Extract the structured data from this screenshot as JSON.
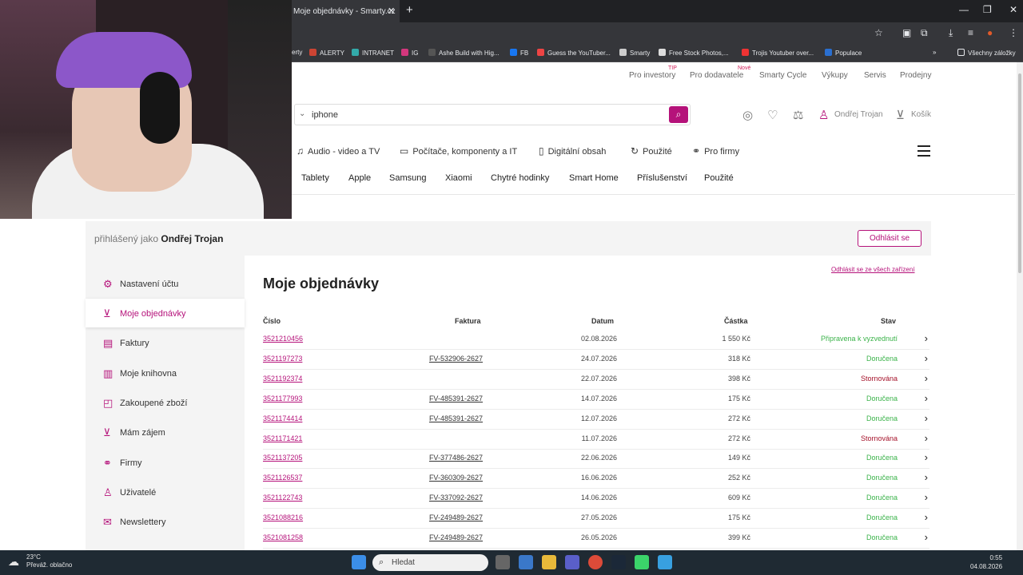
{
  "browser": {
    "tab_title": "Moje objednávky - Smarty.cz",
    "bookmarks": [
      "erty",
      "ALERTY",
      "INTRANET",
      "IG",
      "Ashe Build with Hig...",
      "FB",
      "Guess the YouTuber...",
      "Smarty",
      "Free Stock Photos,...",
      "Trojis Youtuber over...",
      "Populace"
    ],
    "all_bookmarks": "Všechny záložky"
  },
  "topnav": {
    "items": [
      "Pro investory",
      "Pro dodavatele",
      "Smarty Cycle",
      "Výkupy",
      "Servis",
      "Prodejny"
    ],
    "badge_tip": "TIP",
    "badge_new": "Nové"
  },
  "search": {
    "value": "iphone"
  },
  "header": {
    "user": "Ondřej Trojan",
    "cart": "Košík"
  },
  "categories": [
    "Audio - video a TV",
    "Počítače, komponenty a IT",
    "Digitální obsah",
    "Použité",
    "Pro firmy"
  ],
  "subnav": [
    "Tablety",
    "Apple",
    "Samsung",
    "Xiaomi",
    "Chytré hodinky",
    "Smart Home",
    "Příslušenství",
    "Použité"
  ],
  "login": {
    "prefix": "přihlášený jako",
    "name": "Ondřej Trojan",
    "logout": "Odhlásit se",
    "logout_all": "Odhlásit se ze všech zařízení"
  },
  "sidebar": {
    "items": [
      "Nastavení účtu",
      "Moje objednávky",
      "Faktury",
      "Moje knihovna",
      "Zakoupené zboží",
      "Mám zájem",
      "Firmy",
      "Uživatelé",
      "Newslettery"
    ]
  },
  "main": {
    "title": "Moje objednávky",
    "columns": [
      "Číslo",
      "Faktura",
      "Datum",
      "Částka",
      "Stav"
    ],
    "rows": [
      {
        "num": "3521210456",
        "inv": "",
        "date": "02.08.2026",
        "amt": "1 550 Kč",
        "stat": "Připravena k vyzvednutí",
        "color": "#3bb34a"
      },
      {
        "num": "3521197273",
        "inv": "FV-532906-2627",
        "date": "24.07.2026",
        "amt": "318 Kč",
        "stat": "Doručena",
        "color": "#3bb34a"
      },
      {
        "num": "3521192374",
        "inv": "",
        "date": "22.07.2026",
        "amt": "398 Kč",
        "stat": "Stornována",
        "color": "#a5122a"
      },
      {
        "num": "3521177993",
        "inv": "FV-485391-2627",
        "date": "14.07.2026",
        "amt": "175 Kč",
        "stat": "Doručena",
        "color": "#3bb34a"
      },
      {
        "num": "3521174414",
        "inv": "FV-485391-2627",
        "date": "12.07.2026",
        "amt": "272 Kč",
        "stat": "Doručena",
        "color": "#3bb34a"
      },
      {
        "num": "3521171421",
        "inv": "",
        "date": "11.07.2026",
        "amt": "272 Kč",
        "stat": "Stornována",
        "color": "#a5122a"
      },
      {
        "num": "3521137205",
        "inv": "FV-377486-2627",
        "date": "22.06.2026",
        "amt": "149 Kč",
        "stat": "Doručena",
        "color": "#3bb34a"
      },
      {
        "num": "3521126537",
        "inv": "FV-360309-2627",
        "date": "16.06.2026",
        "amt": "252 Kč",
        "stat": "Doručena",
        "color": "#3bb34a"
      },
      {
        "num": "3521122743",
        "inv": "FV-337092-2627",
        "date": "14.06.2026",
        "amt": "609 Kč",
        "stat": "Doručena",
        "color": "#3bb34a"
      },
      {
        "num": "3521088216",
        "inv": "FV-249489-2627",
        "date": "27.05.2026",
        "amt": "175 Kč",
        "stat": "Doručena",
        "color": "#3bb34a"
      },
      {
        "num": "3521081258",
        "inv": "FV-249489-2627",
        "date": "26.05.2026",
        "amt": "399 Kč",
        "stat": "Doručena",
        "color": "#3bb34a"
      }
    ]
  },
  "taskbar": {
    "temp": "23°C",
    "weather": "Převáž. oblačno",
    "search": "Hledat",
    "time": "0:55",
    "date": "04.08.2026"
  }
}
